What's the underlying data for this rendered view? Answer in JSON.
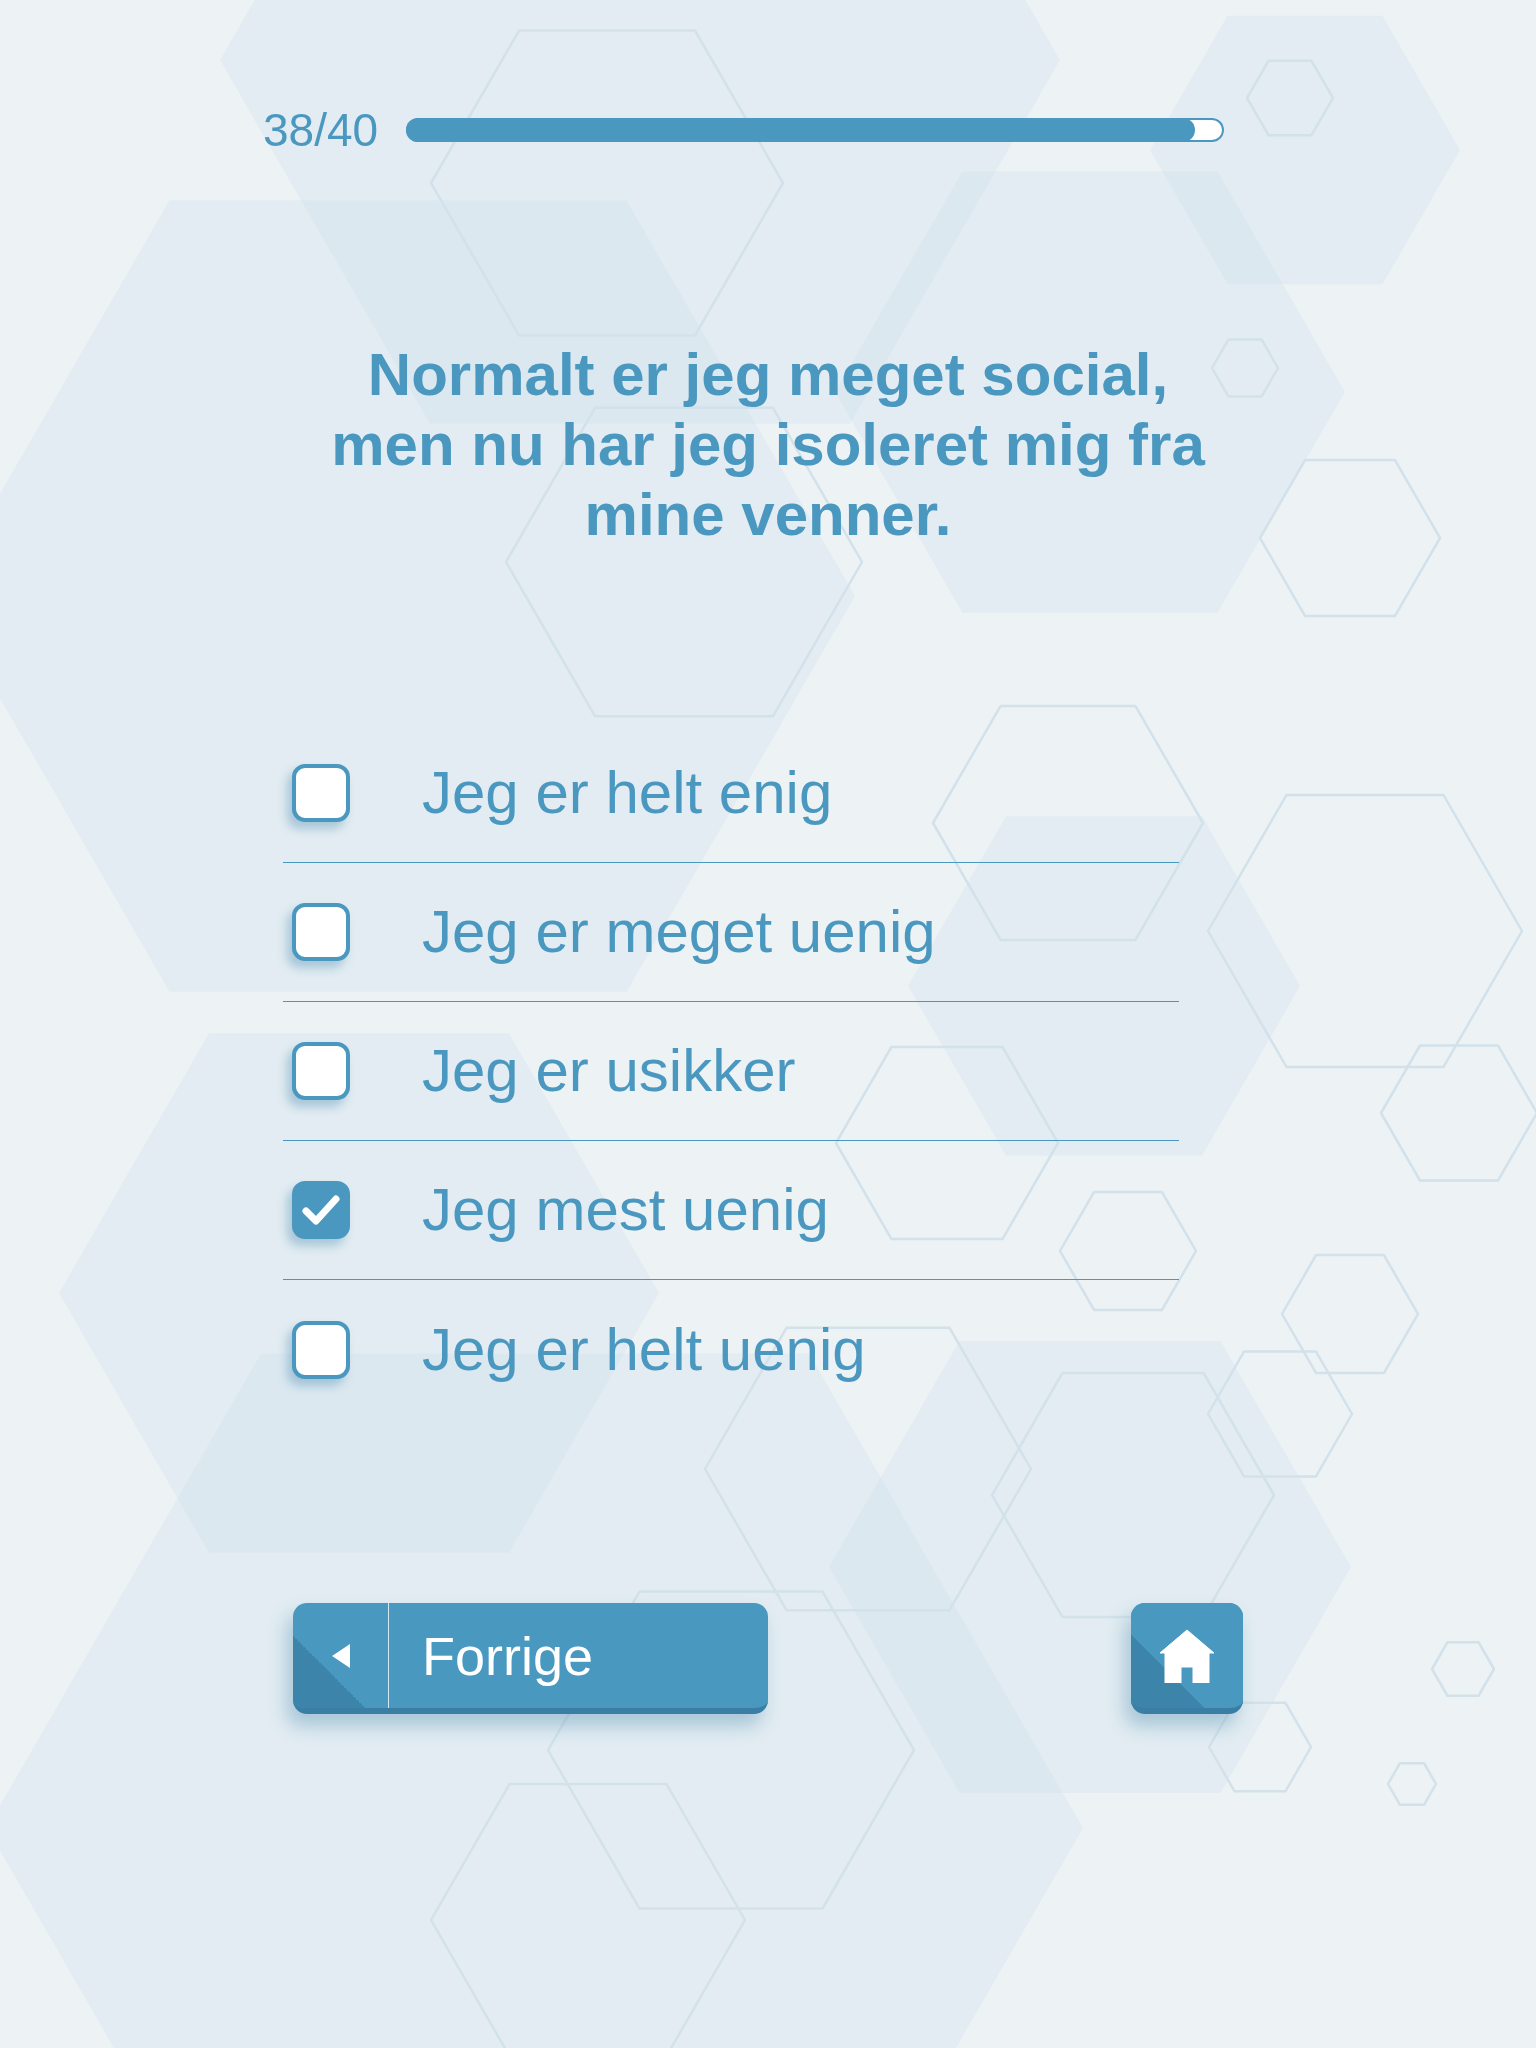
{
  "progress": {
    "label": "38/40",
    "level": 0.965
  },
  "question": "Normalt er jeg meget social, men nu har jeg isoleret mig fra mine venner.",
  "options": [
    {
      "label": "Jeg er helt enig",
      "checked": false
    },
    {
      "label": "Jeg er meget uenig",
      "checked": false
    },
    {
      "label": "Jeg er usikker",
      "checked": false
    },
    {
      "label": "Jeg mest uenig",
      "checked": true
    },
    {
      "label": "Jeg er helt uenig",
      "checked": false
    }
  ],
  "navigation": {
    "previous_label": "Forrige"
  }
}
